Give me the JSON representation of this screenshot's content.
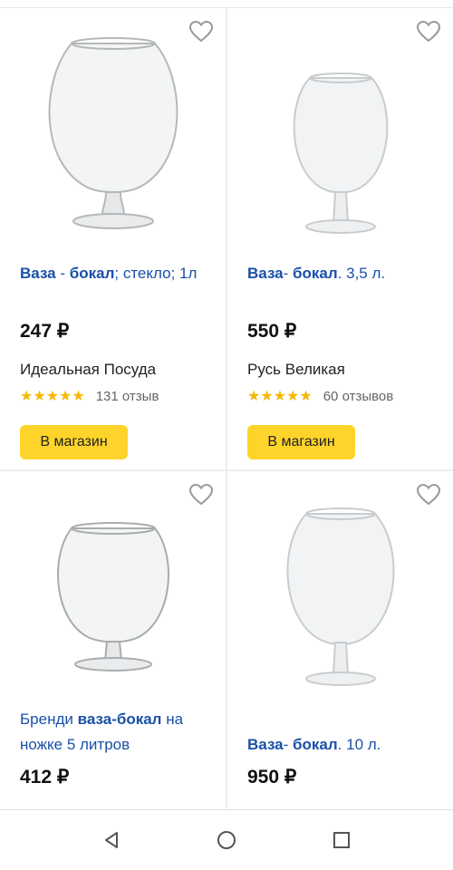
{
  "products": [
    {
      "title_parts": [
        {
          "text": "Ваза",
          "bold": true
        },
        {
          "text": " - ",
          "bold": false
        },
        {
          "text": "бокал",
          "bold": true
        },
        {
          "text": "; стекло; 1л",
          "bold": false
        }
      ],
      "price": "247 ₽",
      "shop": "Идеальная Посуда",
      "rating": 5,
      "reviews": "131 отзыв",
      "button": "В магазин"
    },
    {
      "title_parts": [
        {
          "text": "Ваза",
          "bold": true
        },
        {
          "text": "- ",
          "bold": false
        },
        {
          "text": "бокал",
          "bold": true
        },
        {
          "text": ". 3,5 л.",
          "bold": false
        }
      ],
      "price": "550 ₽",
      "shop": "Русь Великая",
      "rating": 5,
      "reviews": "60 отзывов",
      "button": "В магазин"
    },
    {
      "title_parts": [
        {
          "text": "Бренди ",
          "bold": false
        },
        {
          "text": "ваза-бокал",
          "bold": true
        },
        {
          "text": " на ножке 5 литров",
          "bold": false
        }
      ],
      "price": "412 ₽"
    },
    {
      "title_parts": [
        {
          "text": "Ваза",
          "bold": true
        },
        {
          "text": "- ",
          "bold": false
        },
        {
          "text": "бокал",
          "bold": true
        },
        {
          "text": ". 10 л.",
          "bold": false
        }
      ],
      "price": "950 ₽"
    }
  ],
  "icons": {
    "favorite": "heart-outline-icon",
    "back": "back-triangle-icon",
    "home": "home-circle-icon",
    "recents": "recents-square-icon"
  },
  "colors": {
    "accent_button": "#fed42b",
    "link_title": "#1a50a8",
    "stars": "#f5b800"
  }
}
